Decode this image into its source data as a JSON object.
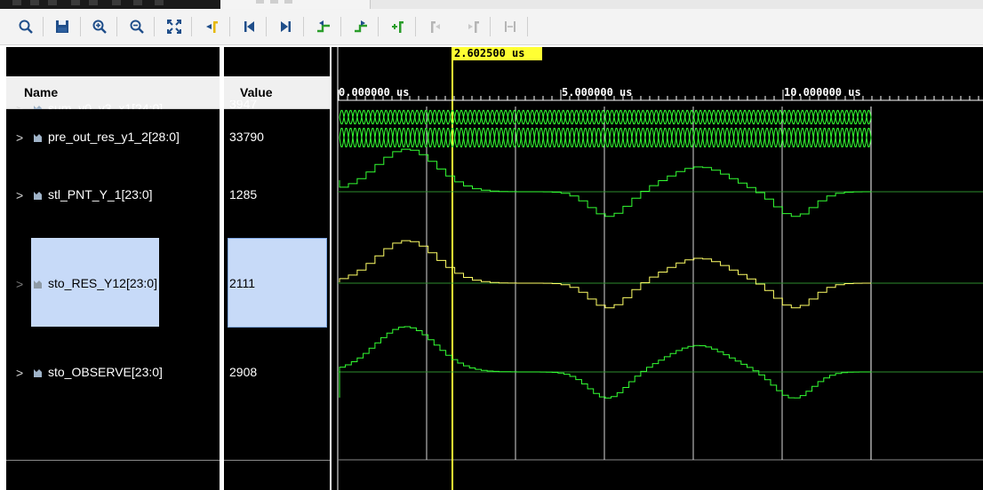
{
  "columns": {
    "name_header": "Name",
    "value_header": "Value"
  },
  "cursor": {
    "time_label": "2.602500 us",
    "color": "#ffff33"
  },
  "timeline": {
    "labels": [
      "0.000000 us",
      "5.000000 us",
      "10.000000 us"
    ]
  },
  "signals": [
    {
      "name": "sum_y0_y3_x1[24:0]",
      "value": "3947",
      "trace_color": "#33ff33",
      "selected": false
    },
    {
      "name": "pre_out_res_y1_2[28:0]",
      "value": "33790",
      "trace_color": "#33ff33",
      "selected": false
    },
    {
      "name": "stl_PNT_Y_1[23:0]",
      "value": "1285",
      "trace_color": "#33ff33",
      "selected": false
    },
    {
      "name": "sto_RES_Y12[23:0]",
      "value": "2111",
      "trace_color": "#ffff66",
      "selected": true
    },
    {
      "name": "sto_OBSERVE[23:0]",
      "value": "2908",
      "trace_color": "#33ff33",
      "selected": false
    }
  ],
  "toolbar": {
    "icons": [
      "search-icon",
      "save-icon",
      "zoom-in-icon",
      "zoom-out-icon",
      "zoom-fit-icon",
      "go-to-cursor-icon",
      "go-to-start-icon",
      "go-to-end-icon",
      "previous-transition-icon",
      "next-transition-icon",
      "add-marker-icon",
      "previous-marker-icon",
      "next-marker-icon",
      "swap-cursors-icon"
    ]
  },
  "colors": {
    "wave_background": "#000000",
    "grid": "#ffffff",
    "selection": "#c7daf8",
    "toolbar_icon": "#1f4e8a",
    "accent_green": "#2a9d2a"
  }
}
